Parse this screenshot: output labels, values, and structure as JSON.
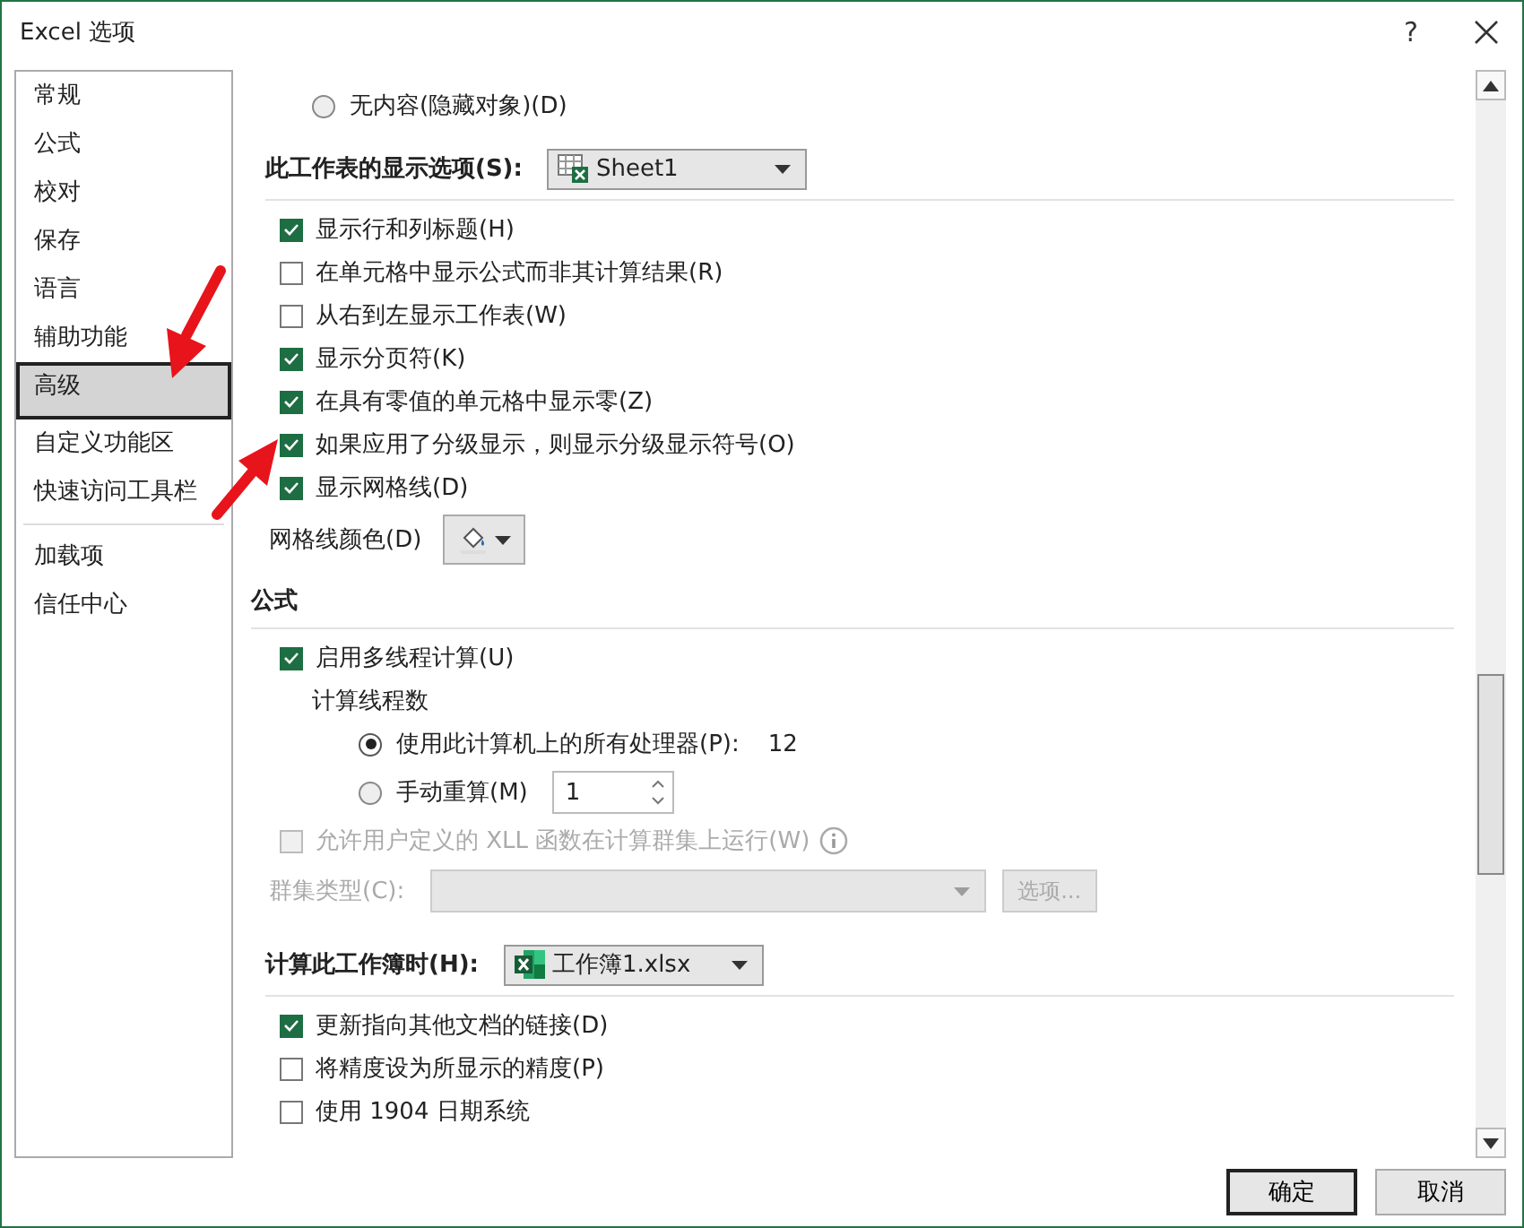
{
  "window": {
    "title": "Excel 选项",
    "help": "?"
  },
  "sidebar": {
    "groups": [
      [
        {
          "label": "常规",
          "selected": false
        },
        {
          "label": "公式",
          "selected": false
        },
        {
          "label": "校对",
          "selected": false
        },
        {
          "label": "保存",
          "selected": false
        },
        {
          "label": "语言",
          "selected": false
        },
        {
          "label": "辅助功能",
          "selected": false
        },
        {
          "label": "高级",
          "selected": true
        },
        {
          "label": "自定义功能区",
          "selected": false
        },
        {
          "label": "快速访问工具栏",
          "selected": false
        }
      ],
      [
        {
          "label": "加载项",
          "selected": false
        },
        {
          "label": "信任中心",
          "selected": false
        }
      ]
    ]
  },
  "content": [
    {
      "kind": "radio",
      "label": "无内容(隐藏对象)(D)",
      "selected": false
    },
    {
      "kind": "sheet_select",
      "label": "此工作表的显示选项(S):",
      "value": "Sheet1"
    },
    {
      "kind": "checkbox",
      "label": "显示行和列标题(H)",
      "checked": true,
      "disabled": false
    },
    {
      "kind": "checkbox",
      "label": "在单元格中显示公式而非其计算结果(R)",
      "checked": false,
      "disabled": false
    },
    {
      "kind": "checkbox",
      "label": "从右到左显示工作表(W)",
      "checked": false,
      "disabled": false
    },
    {
      "kind": "checkbox",
      "label": "显示分页符(K)",
      "checked": true,
      "disabled": false
    },
    {
      "kind": "checkbox",
      "label": "在具有零值的单元格中显示零(Z)",
      "checked": true,
      "disabled": false
    },
    {
      "kind": "checkbox",
      "label": "如果应用了分级显示，则显示分级显示符号(O)",
      "checked": true,
      "disabled": false
    },
    {
      "kind": "checkbox",
      "label": "显示网格线(D)",
      "checked": true,
      "disabled": false
    },
    {
      "kind": "color_picker",
      "label": "网格线颜色(D)"
    },
    {
      "kind": "section",
      "label": "公式"
    },
    {
      "kind": "checkbox",
      "label": "启用多线程计算(U)",
      "checked": true,
      "disabled": false
    },
    {
      "kind": "group",
      "label": "计算线程数",
      "children": [
        {
          "kind": "radio",
          "label": "使用此计算机上的所有处理器(P):",
          "selected": true,
          "value": "12"
        },
        {
          "kind": "radio_spin",
          "label": "手动重算(M)",
          "selected": false,
          "value": "1"
        }
      ]
    },
    {
      "kind": "checkbox",
      "label": "允许用户定义的 XLL 函数在计算群集上运行(W)",
      "checked": false,
      "disabled": true,
      "info": true
    },
    {
      "kind": "combo",
      "label": "群集类型(C):",
      "button": "选项...",
      "disabled": true
    },
    {
      "kind": "workbook_select",
      "label": "计算此工作簿时(H):",
      "value": "工作簿1.xlsx"
    },
    {
      "kind": "checkbox",
      "label": "更新指向其他文档的链接(D)",
      "checked": true,
      "disabled": false
    },
    {
      "kind": "checkbox",
      "label": "将精度设为所显示的精度(P)",
      "checked": false,
      "disabled": false
    },
    {
      "kind": "checkbox",
      "label": "使用 1904 日期系统",
      "checked": false,
      "disabled": false
    }
  ],
  "buttons": [
    "确定",
    "取消"
  ]
}
